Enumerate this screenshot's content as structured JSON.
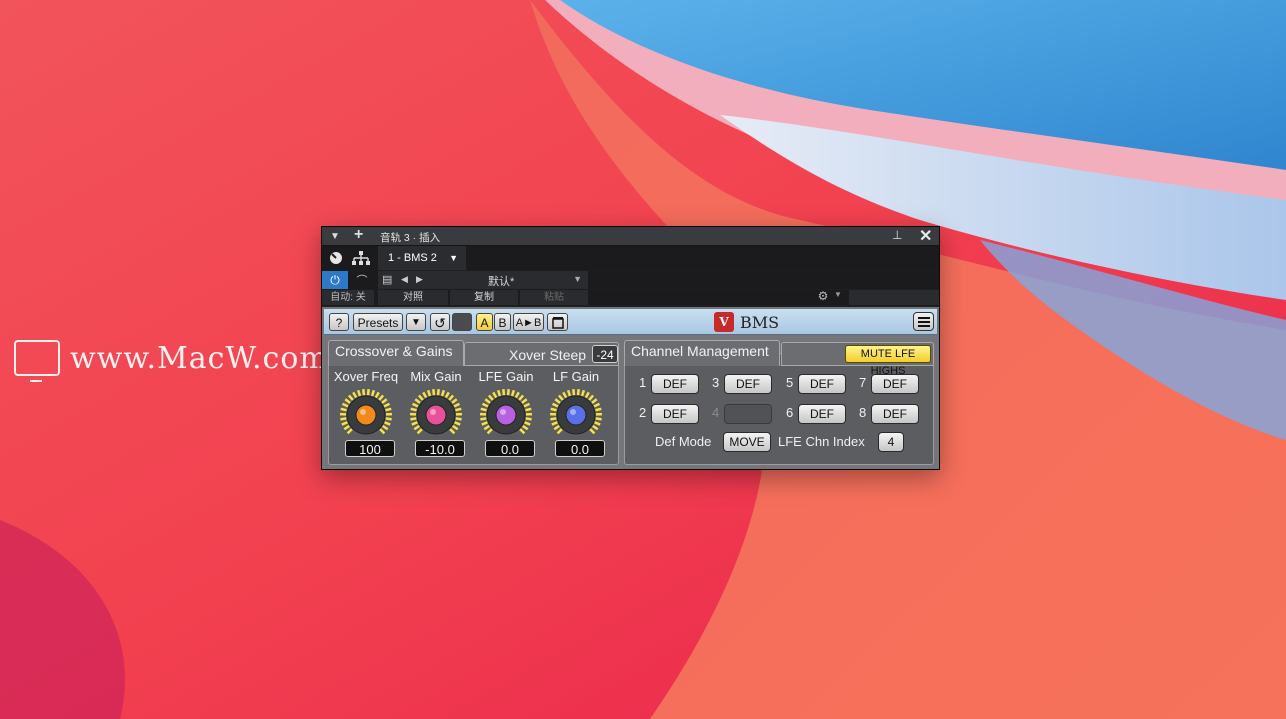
{
  "watermark": "www.MacW.com",
  "window": {
    "title": "音轨 3 · 插入",
    "plugin_slot": "1 - BMS 2",
    "preset_name": "默认*",
    "auto_label": "自动: 关",
    "compare_label": "对照",
    "copy_label": "复制",
    "paste_label": "粘贴"
  },
  "plugin": {
    "help_label": "?",
    "presets_label": "Presets",
    "a_label": "A",
    "b_label": "B",
    "ab_label": "A►B",
    "logo_mark": "V",
    "logo_text": "BMS",
    "crossover": {
      "tab_label": "Crossover & Gains",
      "steep_label": "Xover Steep",
      "steep_value": "-24",
      "knobs": [
        {
          "label": "Xover Freq",
          "value": "100",
          "color": "#f08a1c"
        },
        {
          "label": "Mix Gain",
          "value": "-10.0",
          "color": "#e8509a"
        },
        {
          "label": "LFE Gain",
          "value": "0.0",
          "color": "#b860e0"
        },
        {
          "label": "LF Gain",
          "value": "0.0",
          "color": "#5a6fe8"
        }
      ]
    },
    "channels": {
      "tab_label": "Channel Management",
      "mute_label": "MUTE LFE HIGHS",
      "items": [
        {
          "num": "1",
          "btn": "DEF"
        },
        {
          "num": "3",
          "btn": "DEF"
        },
        {
          "num": "5",
          "btn": "DEF"
        },
        {
          "num": "7",
          "btn": "DEF"
        },
        {
          "num": "2",
          "btn": "DEF"
        },
        {
          "num": "4",
          "btn": ""
        },
        {
          "num": "6",
          "btn": "DEF"
        },
        {
          "num": "8",
          "btn": "DEF"
        }
      ],
      "def_mode_label": "Def Mode",
      "def_mode_value": "MOVE",
      "lfe_index_label": "LFE Chn Index",
      "lfe_index_value": "4"
    }
  },
  "colors": {
    "accent_yellow": "#f3ce2c",
    "power_blue": "#2d79c7"
  }
}
